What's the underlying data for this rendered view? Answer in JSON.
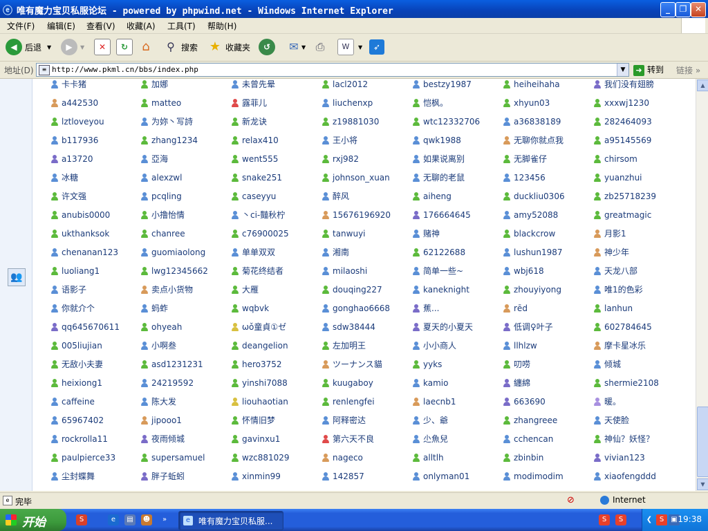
{
  "window": {
    "title": "唯有魔力宝贝私服论坛 - powered by phpwind.net - Windows Internet Explorer",
    "controls": [
      "_",
      "❐",
      "✕"
    ]
  },
  "menu": [
    "文件(F)",
    "编辑(E)",
    "查看(V)",
    "收藏(A)",
    "工具(T)",
    "帮助(H)"
  ],
  "toolbar": {
    "back": "后退",
    "search": "搜索",
    "favorites": "收藏夹"
  },
  "address": {
    "label": "地址(D)",
    "url": "http://www.pkml.cn/bbs/index.php",
    "go": "转到",
    "links": "链接"
  },
  "colors": {
    "green": "#5cba3c",
    "blue": "#5a8fd6",
    "orange": "#d89a5a",
    "purple": "#7a6cc8",
    "red": "#e04a4a",
    "yellow": "#d8c040",
    "lavender": "#a890e0"
  },
  "users": [
    [
      {
        "n": "卡卡猪",
        "c": "blue"
      },
      {
        "n": "加娜",
        "c": "green"
      },
      {
        "n": "未曾先晕",
        "c": "blue"
      },
      {
        "n": "lacl2012",
        "c": "green"
      },
      {
        "n": "bestzy1987",
        "c": "blue"
      },
      {
        "n": "heiheihaha",
        "c": "green"
      },
      {
        "n": "我们没有翅膀",
        "c": "purple"
      }
    ],
    [
      {
        "n": "a442530",
        "c": "orange"
      },
      {
        "n": "matteo",
        "c": "green"
      },
      {
        "n": "露菲儿",
        "c": "red"
      },
      {
        "n": "liuchenxp",
        "c": "blue"
      },
      {
        "n": "恺枫。",
        "c": "green"
      },
      {
        "n": "xhyun03",
        "c": "green"
      },
      {
        "n": "xxxwj1230",
        "c": "green"
      }
    ],
    [
      {
        "n": "lztloveyou",
        "c": "green"
      },
      {
        "n": "为妳丶写詩",
        "c": "blue"
      },
      {
        "n": "新龙诀",
        "c": "green"
      },
      {
        "n": "z19881030",
        "c": "green"
      },
      {
        "n": "wtc12332706",
        "c": "green"
      },
      {
        "n": "a36838189",
        "c": "blue"
      },
      {
        "n": "282464093",
        "c": "green"
      }
    ],
    [
      {
        "n": "b117936",
        "c": "blue"
      },
      {
        "n": "zhang1234",
        "c": "green"
      },
      {
        "n": "relax410",
        "c": "green"
      },
      {
        "n": "王小将",
        "c": "blue"
      },
      {
        "n": "qwk1988",
        "c": "blue"
      },
      {
        "n": "无聊你就点我",
        "c": "orange"
      },
      {
        "n": "a95145569",
        "c": "green"
      }
    ],
    [
      {
        "n": "a13720",
        "c": "purple"
      },
      {
        "n": "亞海",
        "c": "blue"
      },
      {
        "n": "went555",
        "c": "green"
      },
      {
        "n": "rxj982",
        "c": "green"
      },
      {
        "n": "如果说离别",
        "c": "blue"
      },
      {
        "n": "无脚雀仔",
        "c": "green"
      },
      {
        "n": "chirsom",
        "c": "green"
      }
    ],
    [
      {
        "n": "冰糖",
        "c": "blue"
      },
      {
        "n": "alexzwl",
        "c": "blue"
      },
      {
        "n": "snake251",
        "c": "green"
      },
      {
        "n": "johnson_xuan",
        "c": "green"
      },
      {
        "n": "无聊的老鼠",
        "c": "blue"
      },
      {
        "n": "123456",
        "c": "blue"
      },
      {
        "n": "yuanzhui",
        "c": "green"
      }
    ],
    [
      {
        "n": "许文强",
        "c": "green"
      },
      {
        "n": "pcqling",
        "c": "blue"
      },
      {
        "n": "caseyyu",
        "c": "green"
      },
      {
        "n": "醉风",
        "c": "blue"
      },
      {
        "n": "aiheng",
        "c": "green"
      },
      {
        "n": "duckliu0306",
        "c": "green"
      },
      {
        "n": "zb25718239",
        "c": "green"
      }
    ],
    [
      {
        "n": "anubis0000",
        "c": "green"
      },
      {
        "n": "小撸怡情",
        "c": "green"
      },
      {
        "n": "丶ci-豔秋柠",
        "c": "blue"
      },
      {
        "n": "15676196920",
        "c": "orange"
      },
      {
        "n": "176664645",
        "c": "purple"
      },
      {
        "n": "amy52088",
        "c": "blue"
      },
      {
        "n": "greatmagic",
        "c": "green"
      }
    ],
    [
      {
        "n": "ukthanksok",
        "c": "green"
      },
      {
        "n": "chanree",
        "c": "green"
      },
      {
        "n": "c76900025",
        "c": "green"
      },
      {
        "n": "tanwuyi",
        "c": "green"
      },
      {
        "n": "赌神",
        "c": "blue"
      },
      {
        "n": "blackcrow",
        "c": "green"
      },
      {
        "n": "月影1",
        "c": "orange"
      }
    ],
    [
      {
        "n": "chenanan123",
        "c": "blue"
      },
      {
        "n": "guomiaolong",
        "c": "blue"
      },
      {
        "n": "单单双双",
        "c": "blue"
      },
      {
        "n": "湘南",
        "c": "blue"
      },
      {
        "n": "62122688",
        "c": "green"
      },
      {
        "n": "lushun1987",
        "c": "blue"
      },
      {
        "n": "神少年",
        "c": "orange"
      }
    ],
    [
      {
        "n": "luoliang1",
        "c": "green"
      },
      {
        "n": "lwg12345662",
        "c": "green"
      },
      {
        "n": "菊花终结者",
        "c": "green"
      },
      {
        "n": "milaoshi",
        "c": "blue"
      },
      {
        "n": "简单一些~",
        "c": "blue"
      },
      {
        "n": "wbj618",
        "c": "blue"
      },
      {
        "n": "天龙八部",
        "c": "blue"
      }
    ],
    [
      {
        "n": "语影子",
        "c": "blue"
      },
      {
        "n": "卖点小货物",
        "c": "orange"
      },
      {
        "n": "大雁",
        "c": "green"
      },
      {
        "n": "douqing227",
        "c": "green"
      },
      {
        "n": "kaneknight",
        "c": "blue"
      },
      {
        "n": "zhouyiyong",
        "c": "green"
      },
      {
        "n": "唯1的色彩",
        "c": "blue"
      }
    ],
    [
      {
        "n": "你就介个",
        "c": "blue"
      },
      {
        "n": "蚂蚱",
        "c": "blue"
      },
      {
        "n": "wqbvk",
        "c": "green"
      },
      {
        "n": "gonghao6668",
        "c": "blue"
      },
      {
        "n": "蕉...",
        "c": "purple"
      },
      {
        "n": "rēd",
        "c": "orange"
      },
      {
        "n": "lanhun",
        "c": "green"
      }
    ],
    [
      {
        "n": "qq645670611",
        "c": "purple"
      },
      {
        "n": "ohyeah",
        "c": "green"
      },
      {
        "n": "ωǒ童貞①ゼ",
        "c": "yellow"
      },
      {
        "n": "sdw38444",
        "c": "blue"
      },
      {
        "n": "夏天的小夏天",
        "c": "purple"
      },
      {
        "n": "低调♀叶子",
        "c": "purple"
      },
      {
        "n": "602784645",
        "c": "green"
      }
    ],
    [
      {
        "n": "005liujian",
        "c": "green"
      },
      {
        "n": "小啊叁",
        "c": "blue"
      },
      {
        "n": "deangelion",
        "c": "green"
      },
      {
        "n": "左加明王",
        "c": "green"
      },
      {
        "n": "小小商人",
        "c": "blue"
      },
      {
        "n": "llhlzw",
        "c": "blue"
      },
      {
        "n": "摩卡星冰乐",
        "c": "orange"
      }
    ],
    [
      {
        "n": "无敌小夫妻",
        "c": "green"
      },
      {
        "n": "asd1231231",
        "c": "green"
      },
      {
        "n": "hero3752",
        "c": "green"
      },
      {
        "n": "ツーナンス貓",
        "c": "orange"
      },
      {
        "n": "yyks",
        "c": "green"
      },
      {
        "n": "叨唠",
        "c": "green"
      },
      {
        "n": "倾城",
        "c": "blue"
      }
    ],
    [
      {
        "n": "heixiong1",
        "c": "green"
      },
      {
        "n": "24219592",
        "c": "blue"
      },
      {
        "n": "yinshi7088",
        "c": "green"
      },
      {
        "n": "kuugaboy",
        "c": "green"
      },
      {
        "n": "kamio",
        "c": "blue"
      },
      {
        "n": "纏綿",
        "c": "purple"
      },
      {
        "n": "shermie2108",
        "c": "green"
      }
    ],
    [
      {
        "n": "caffeine",
        "c": "blue"
      },
      {
        "n": "陈大发",
        "c": "blue"
      },
      {
        "n": "liouhaotian",
        "c": "yellow"
      },
      {
        "n": "renlengfei",
        "c": "green"
      },
      {
        "n": "laecnb1",
        "c": "orange"
      },
      {
        "n": "663690",
        "c": "purple"
      },
      {
        "n": "暖。",
        "c": "lavender"
      }
    ],
    [
      {
        "n": "65967402",
        "c": "blue"
      },
      {
        "n": "jipooo1",
        "c": "orange"
      },
      {
        "n": "怀情旧梦",
        "c": "green"
      },
      {
        "n": "阿释密达",
        "c": "blue"
      },
      {
        "n": "少、爺",
        "c": "blue"
      },
      {
        "n": "zhangreee",
        "c": "green"
      },
      {
        "n": "天使脸",
        "c": "blue"
      }
    ],
    [
      {
        "n": "rockrolla11",
        "c": "blue"
      },
      {
        "n": "夜雨倾城",
        "c": "purple"
      },
      {
        "n": "gavinxu1",
        "c": "green"
      },
      {
        "n": "第六天不良",
        "c": "red"
      },
      {
        "n": "尐魚兒",
        "c": "blue"
      },
      {
        "n": "cchencan",
        "c": "blue"
      },
      {
        "n": "神仙？妖怪？",
        "c": "green"
      }
    ],
    [
      {
        "n": "paulpierce33",
        "c": "green"
      },
      {
        "n": "supersamuel",
        "c": "green"
      },
      {
        "n": "wzc881029",
        "c": "green"
      },
      {
        "n": "nageco",
        "c": "orange"
      },
      {
        "n": "alltlh",
        "c": "green"
      },
      {
        "n": "zbinbin",
        "c": "green"
      },
      {
        "n": "vivian123",
        "c": "purple"
      }
    ],
    [
      {
        "n": "尘封蝶舞",
        "c": "blue"
      },
      {
        "n": "胖子蚯蚓",
        "c": "purple"
      },
      {
        "n": "xinmin99",
        "c": "blue"
      },
      {
        "n": "142857",
        "c": "blue"
      },
      {
        "n": "onlyman01",
        "c": "blue"
      },
      {
        "n": "modimodim",
        "c": "blue"
      },
      {
        "n": "xiaofengddd",
        "c": "blue"
      }
    ]
  ],
  "status": {
    "text": "完毕",
    "zone": "Internet"
  },
  "taskbar": {
    "start": "开始",
    "task_title": "唯有魔力宝贝私服...",
    "clock": "19:38"
  }
}
